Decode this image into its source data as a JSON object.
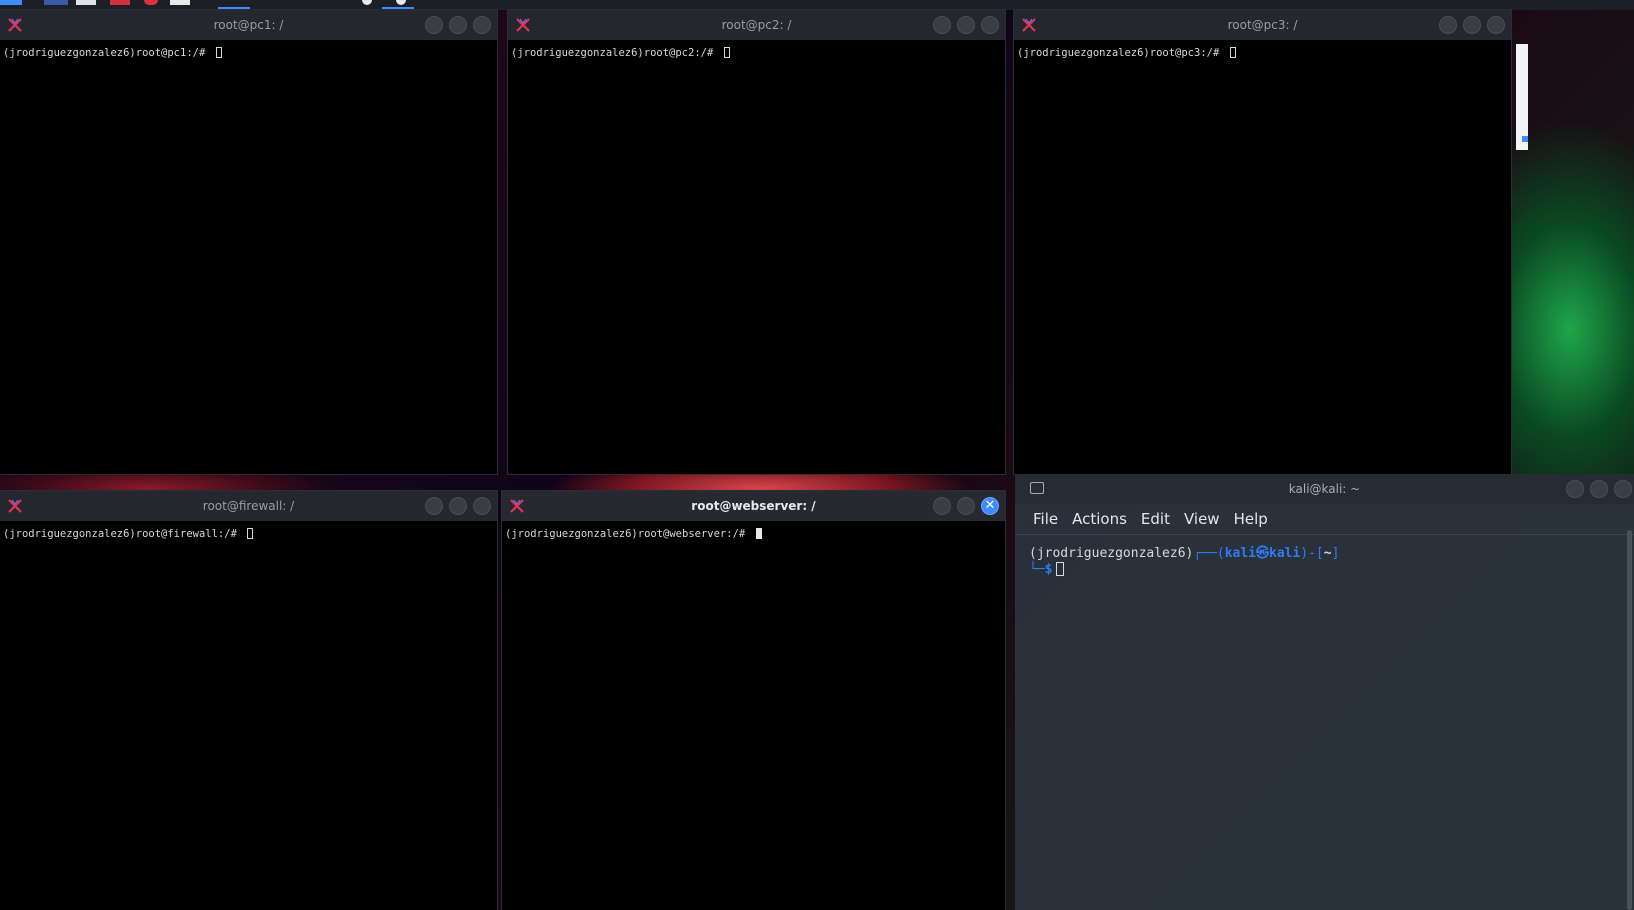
{
  "windows": [
    {
      "id": "pc1",
      "title": "root@pc1: /",
      "prompt": "(jrodriguezgonzalez6)root@pc1:/# ",
      "active": false
    },
    {
      "id": "pc2",
      "title": "root@pc2: /",
      "prompt": "(jrodriguezgonzalez6)root@pc2:/# ",
      "active": false
    },
    {
      "id": "pc3",
      "title": "root@pc3: /",
      "prompt": "(jrodriguezgonzalez6)root@pc3:/# ",
      "active": false
    },
    {
      "id": "firewall",
      "title": "root@firewall: /",
      "prompt": "(jrodriguezgonzalez6)root@firewall:/# ",
      "active": false
    },
    {
      "id": "webserver",
      "title": "root@webserver: /",
      "prompt": "(jrodriguezgonzalez6)root@webserver:/# ",
      "active": true
    }
  ],
  "kali": {
    "title": "kali@kali: ~",
    "menu": [
      "File",
      "Actions",
      "Edit",
      "View",
      "Help"
    ],
    "line1_user": "(jrodriguezgonzalez6)",
    "line1_box": "┌──(",
    "line1_userhost": "kali㉿kali",
    "line1_sep": ")-[",
    "line1_dir": "~",
    "line1_end": "]",
    "line2_corner": "└─",
    "line2_prompt": "$"
  },
  "colors": {
    "accent": "#3d8cff",
    "kali_blue": "#2f7cf0",
    "xterm_logo": "#e0335a"
  },
  "icons": {
    "xwin": "x-logo-icon",
    "kali": "terminal-icon"
  }
}
